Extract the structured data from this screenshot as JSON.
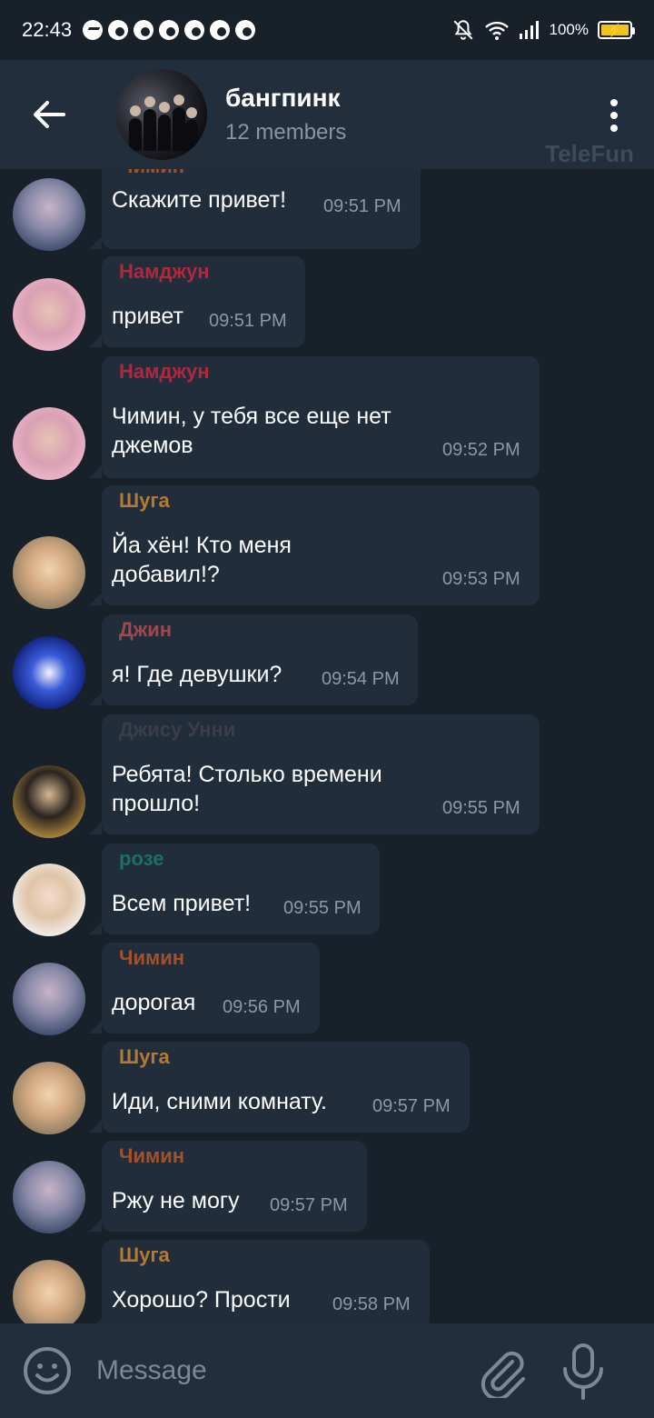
{
  "status_bar": {
    "time": "22:43",
    "battery_text": "100%",
    "notification_icons": [
      "messenger-icon",
      "chrome-icon",
      "chrome-icon",
      "chrome-icon",
      "chrome-icon",
      "chrome-icon",
      "chrome-icon"
    ]
  },
  "header": {
    "title": "бангпинк",
    "subtitle": "12 members",
    "watermark": "TeleFun"
  },
  "colors": {
    "background": "#182029",
    "header": "#222e3c",
    "bubble": "#222d3b",
    "timestamp": "#8c98a8"
  },
  "messages": [
    {
      "sender": "Чимин",
      "sender_color": "#a0522d",
      "text": "Скажите привет!",
      "time": "09:51 PM",
      "avatar": "avatar-jimin"
    },
    {
      "sender": "Намджун",
      "sender_color": "#b0283c",
      "text": "привет",
      "time": "09:51 PM",
      "avatar": "avatar-namjoon"
    },
    {
      "sender": "Намджун",
      "sender_color": "#b0283c",
      "text": "Чимин, у тебя все еще нет\nджемов",
      "time": "09:52 PM",
      "avatar": "avatar-namjoon"
    },
    {
      "sender": "Шуга",
      "sender_color": "#b57a30",
      "text": "Йа хён! Кто меня\nдобавил!?",
      "time": "09:53 PM",
      "avatar": "avatar-suga"
    },
    {
      "sender": "Джин",
      "sender_color": "#a5454e",
      "text": "я!  Где девушки?",
      "time": "09:54 PM",
      "avatar": "avatar-jin"
    },
    {
      "sender": "Джису Унни",
      "sender_color": "#3b3e47",
      "text": "Ребята! Столько времени\nпрошло!",
      "time": "09:55 PM",
      "avatar": "avatar-jisoo"
    },
    {
      "sender": "розе",
      "sender_color": "#1f6f66",
      "text": "Всем привет!",
      "time": "09:55 PM",
      "avatar": "avatar-rose"
    },
    {
      "sender": "Чимин",
      "sender_color": "#a0522d",
      "text": "дорогая",
      "time": "09:56 PM",
      "avatar": "avatar-jimin"
    },
    {
      "sender": "Шуга",
      "sender_color": "#b57a30",
      "text": "Иди, сними комнату.",
      "time": "09:57 PM",
      "avatar": "avatar-suga"
    },
    {
      "sender": "Чимин",
      "sender_color": "#a0522d",
      "text": "Ржу не могу",
      "time": "09:57 PM",
      "avatar": "avatar-jimin"
    },
    {
      "sender": "Шуга",
      "sender_color": "#b57a30",
      "text": "Хорошо?  Прости",
      "time": "09:58 PM",
      "avatar": "avatar-suga"
    }
  ],
  "input": {
    "placeholder": "Message"
  }
}
